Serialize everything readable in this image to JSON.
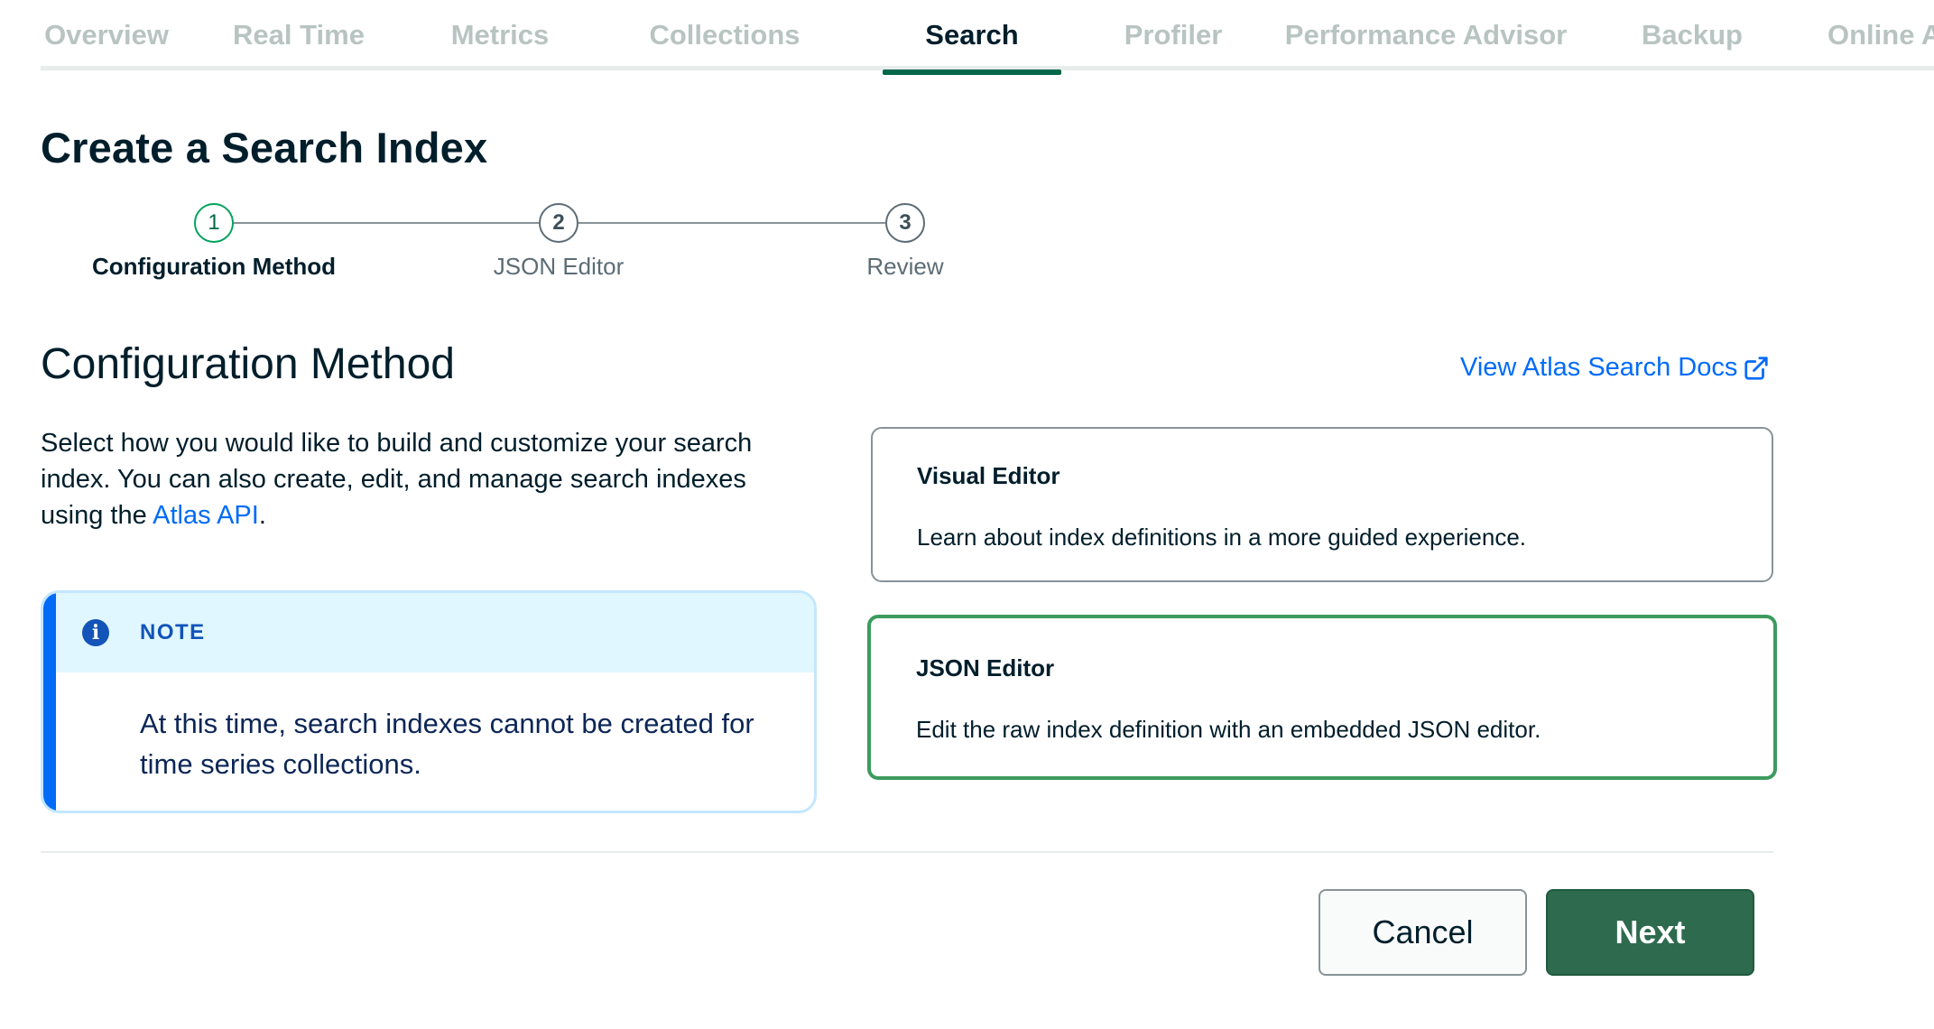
{
  "tabs": [
    {
      "label": "Overview"
    },
    {
      "label": "Real Time"
    },
    {
      "label": "Metrics"
    },
    {
      "label": "Collections"
    },
    {
      "label": "Search",
      "active": true
    },
    {
      "label": "Profiler"
    },
    {
      "label": "Performance Advisor"
    },
    {
      "label": "Backup"
    },
    {
      "label": "Online A"
    }
  ],
  "page_title": "Create a Search Index",
  "stepper": {
    "steps": [
      {
        "number": "1",
        "label": "Configuration Method",
        "status": "active"
      },
      {
        "number": "2",
        "label": "JSON Editor",
        "status": "upcoming"
      },
      {
        "number": "3",
        "label": "Review",
        "status": "upcoming"
      }
    ]
  },
  "section": {
    "title": "Configuration Method",
    "docs_link": "View Atlas Search Docs",
    "description_before": "Select how you would like to build and customize your search index. You can also create, edit, and manage search indexes using the ",
    "description_link": "Atlas API",
    "description_after": "."
  },
  "note": {
    "icon": "info-icon",
    "heading": "NOTE",
    "body": "At this time, search indexes cannot be created for time series collections."
  },
  "options": {
    "visual": {
      "title": "Visual Editor",
      "description": "Learn about index definitions in a more guided experience.",
      "selected": false
    },
    "json": {
      "title": "JSON Editor",
      "description": "Edit the raw index definition with an embedded JSON editor.",
      "selected": true
    }
  },
  "footer": {
    "cancel_label": "Cancel",
    "next_label": "Next"
  },
  "colors": {
    "accent_green": "#00684a",
    "selected_border": "#3d9b5f",
    "link_blue": "#016bf8",
    "note_bg": "#e1f7ff",
    "next_button": "#2e6b4e"
  }
}
